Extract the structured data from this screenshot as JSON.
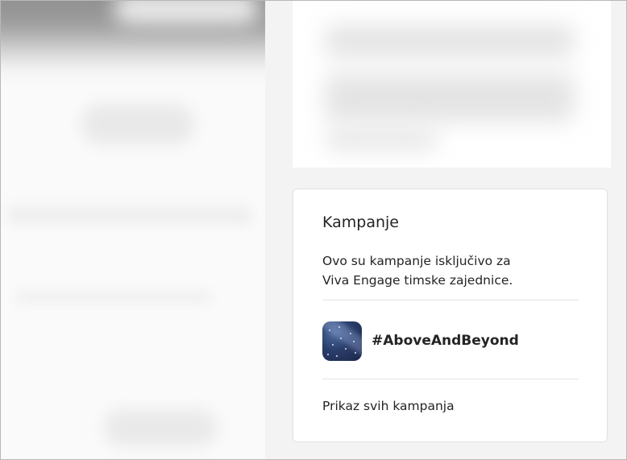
{
  "campaigns_card": {
    "title": "Kampanje",
    "description_line1": "Ovo su kampanje isključivo za",
    "description_line2": "Viva Engage timske zajednice.",
    "items": [
      {
        "name": "#AboveAndBeyond",
        "thumbnail_icon": "starry-sky-image"
      }
    ],
    "view_all_label": "Prikaz svih kampanja"
  },
  "colors": {
    "page_background": "#f3f3f3",
    "card_background": "#ffffff",
    "text": "#242424",
    "divider": "#e3e3e3",
    "thumbnail_dark_blue": "#1a2548"
  }
}
